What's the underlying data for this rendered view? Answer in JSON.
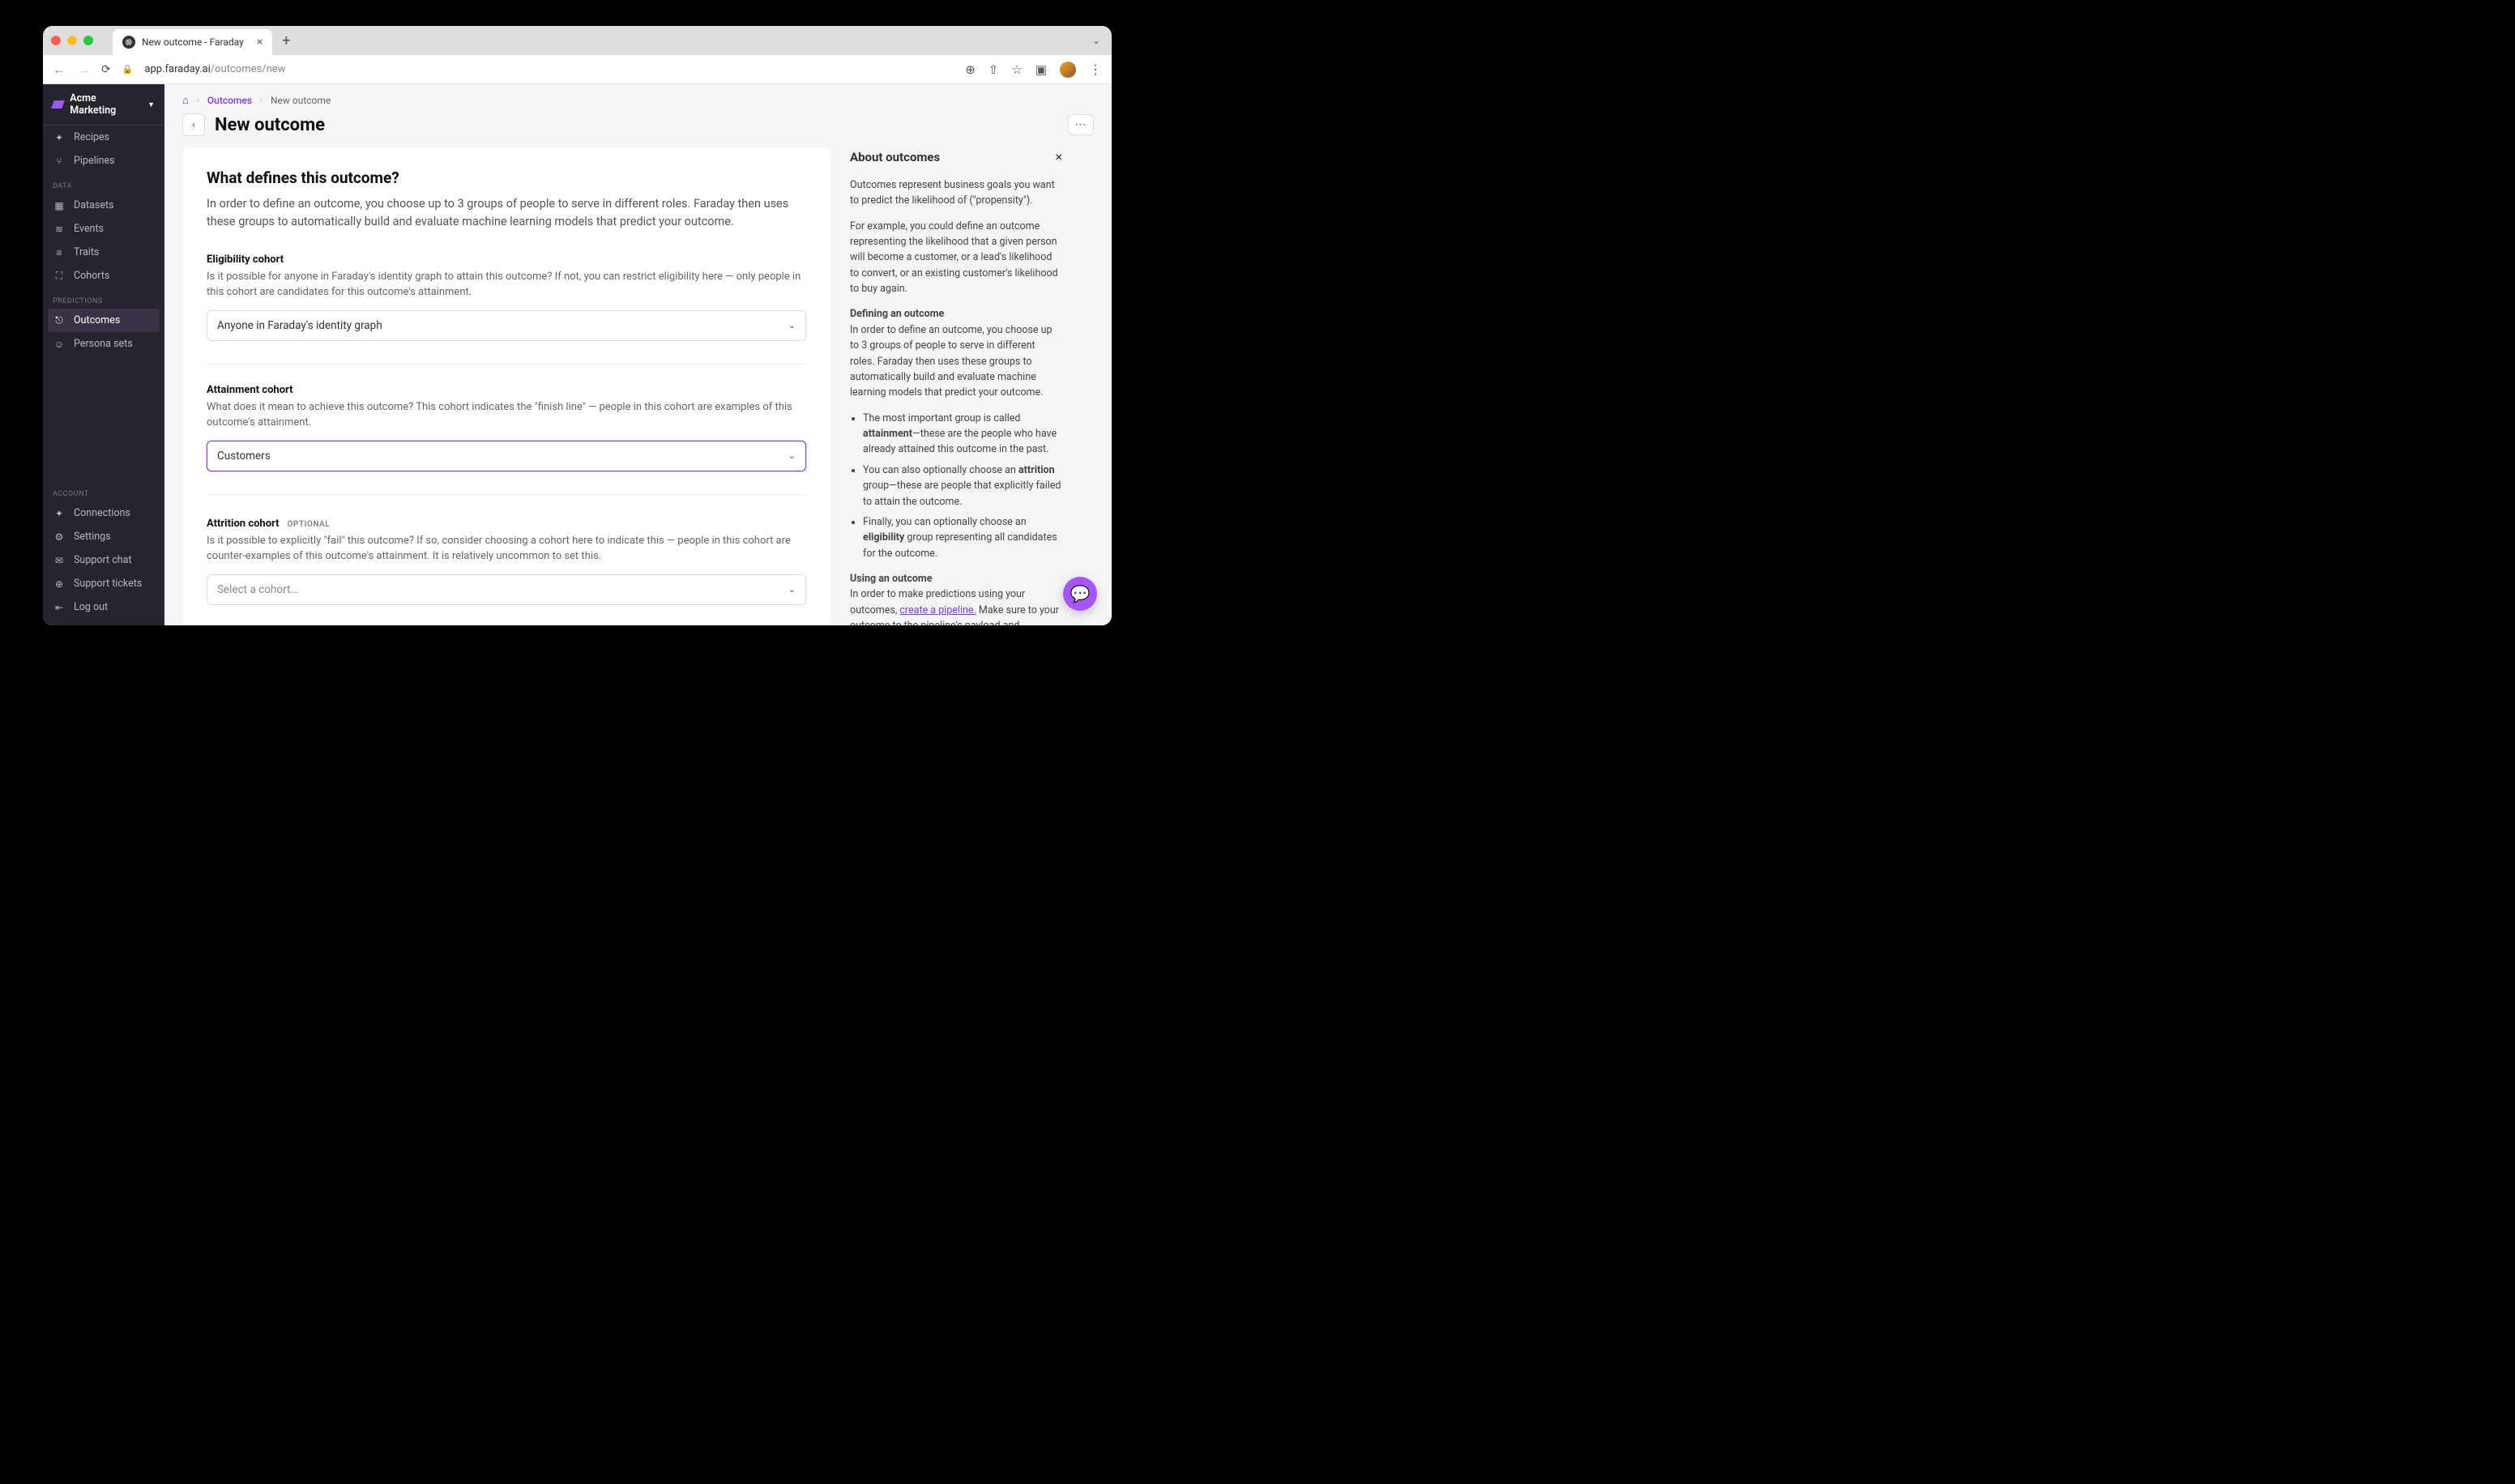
{
  "browser": {
    "tab_title": "New outcome - Faraday",
    "url_domain": "app.faraday.ai",
    "url_path": "/outcomes/new"
  },
  "workspace": {
    "name": "Acme Marketing"
  },
  "sidebar": {
    "main": [
      {
        "icon": "✦",
        "label": "Recipes"
      },
      {
        "icon": "⑂",
        "label": "Pipelines"
      }
    ],
    "data_heading": "DATA",
    "data": [
      {
        "icon": "▦",
        "label": "Datasets"
      },
      {
        "icon": "≋",
        "label": "Events"
      },
      {
        "icon": "≡",
        "label": "Traits"
      },
      {
        "icon": "⛶",
        "label": "Cohorts"
      }
    ],
    "pred_heading": "PREDICTIONS",
    "predictions": [
      {
        "icon": "⎋",
        "label": "Outcomes",
        "active": true
      },
      {
        "icon": "☺",
        "label": "Persona sets"
      }
    ],
    "account_heading": "ACCOUNT",
    "account": [
      {
        "icon": "✦",
        "label": "Connections"
      },
      {
        "icon": "⚙",
        "label": "Settings"
      },
      {
        "icon": "✉",
        "label": "Support chat"
      },
      {
        "icon": "⊕",
        "label": "Support tickets"
      },
      {
        "icon": "⇤",
        "label": "Log out"
      }
    ]
  },
  "breadcrumb": {
    "outcomes": "Outcomes",
    "current": "New outcome"
  },
  "page": {
    "title": "New outcome"
  },
  "form": {
    "heading": "What defines this outcome?",
    "lead": "In order to define an outcome, you choose up to 3 groups of people to serve in different roles. Faraday then uses these groups to automatically build and evaluate machine learning models that predict your outcome.",
    "eligibility": {
      "label": "Eligibility cohort",
      "desc": "Is it possible for anyone in Faraday's identity graph to attain this outcome? If not, you can restrict eligibility here — only people in this cohort are candidates for this outcome's attainment.",
      "value": "Anyone in Faraday's identity graph"
    },
    "attainment": {
      "label": "Attainment cohort",
      "desc": "What does it mean to achieve this outcome? This cohort indicates the \"finish line\" — people in this cohort are examples of this outcome's attainment.",
      "value": "Customers"
    },
    "attrition": {
      "label": "Attrition cohort",
      "optional": "OPTIONAL",
      "desc": "Is it possible to explicitly \"fail\" this outcome? If so, consider choosing a cohort here to indicate this — people in this cohort are counter-examples of this outcome's attainment. It is relatively uncommon to set this.",
      "placeholder": "Select a cohort..."
    }
  },
  "help": {
    "title": "About outcomes",
    "p1": "Outcomes represent business goals you want to predict the likelihood of (\"propensity\").",
    "p2": "For example, you could define an outcome representing the likelihood that a given person will become a customer, or a lead's likelihood to convert, or an existing customer's likelihood to buy again.",
    "h_def": "Defining an outcome",
    "p3": "In order to define an outcome, you choose up to 3 groups of people to serve in different roles. Faraday then uses these groups to automatically build and evaluate machine learning models that predict your outcome.",
    "li1a": "The most important group is called ",
    "li1b": "attainment",
    "li1c": "—these are the people who have already attained this outcome in the past.",
    "li2a": "You can also optionally choose an ",
    "li2b": "attrition",
    "li2c": " group—these are people that explicitly failed to attain the outcome.",
    "li3a": "Finally, you can optionally choose an ",
    "li3b": "eligibility",
    "li3c": " group representing all candidates for the outcome.",
    "h_use": "Using an outcome",
    "p4a": "In order to make predictions using your outcomes, ",
    "p4link": "create a pipeline.",
    "p4b": " Make sure to your outcome to the pipeline's payload and"
  }
}
